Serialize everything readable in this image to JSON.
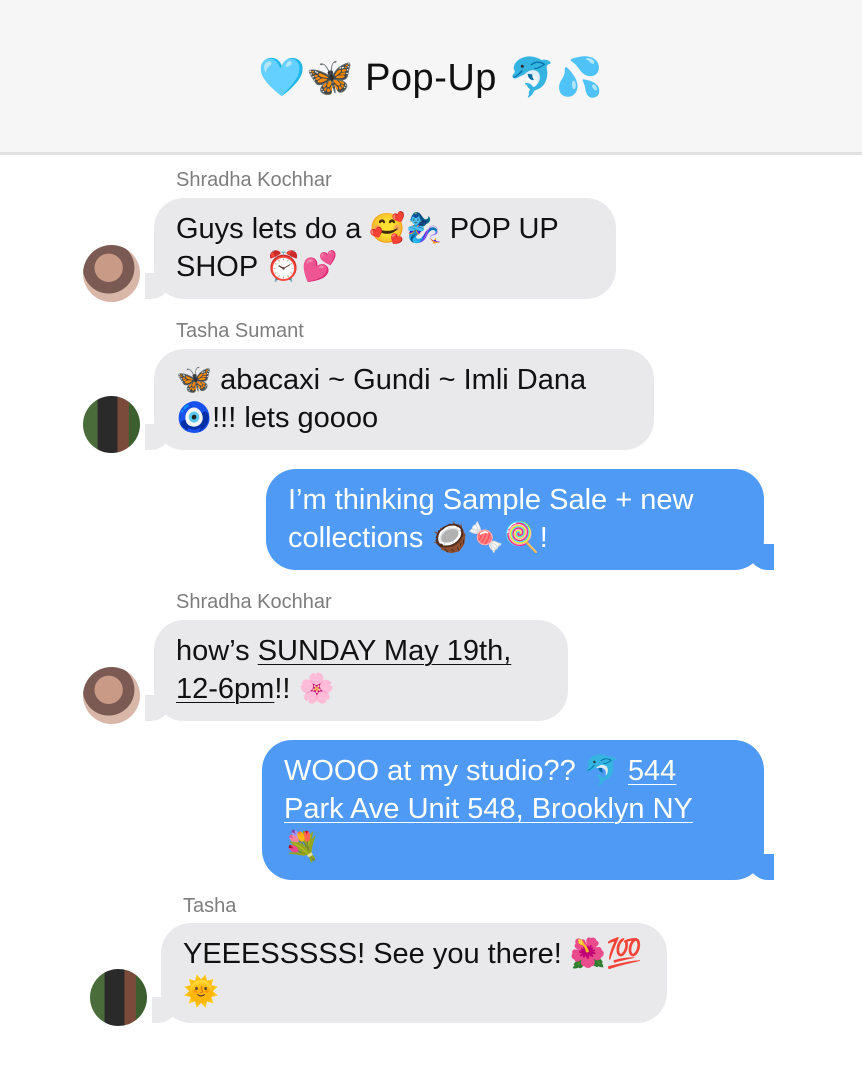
{
  "chat": {
    "title": "🩵🦋 Pop-Up 🐬💦"
  },
  "messages": [
    {
      "sender": "Shradha Kochhar",
      "text": [
        "Guys lets do a 🥰🧞‍♀️ POP UP",
        "SHOP ⏰💕"
      ]
    },
    {
      "sender": "Tasha Sumant",
      "text": [
        "🦋 abacaxi ~ Gundi ~ Imli Dana",
        "🧿!!! lets goooo"
      ]
    },
    {
      "text": [
        "I’m thinking Sample Sale + new",
        "collections 🥥🍬🍭!"
      ]
    },
    {
      "sender": "Shradha Kochhar",
      "text_parts": {
        "a": "how’s ",
        "b": "SUNDAY May 19th,",
        "c": "12-6pm",
        "d": "!! 🌸"
      }
    },
    {
      "text_parts": {
        "a": "WOOO at my studio?? 🐬 ",
        "b": "544",
        "c": "Park Ave Unit 548, Brooklyn NY",
        "d": "💐"
      }
    },
    {
      "sender": "Tasha",
      "text": [
        "YEEESSSSS! See you there! 🌺💯",
        "🌞"
      ]
    }
  ]
}
